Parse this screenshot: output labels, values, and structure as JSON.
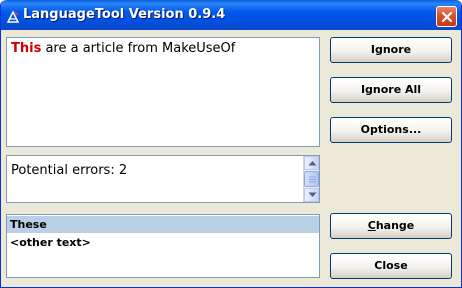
{
  "window": {
    "title": "LanguageTool Version 0.9.4",
    "accent": "#0054E3",
    "close_color": "#D9522C"
  },
  "editor": {
    "error_word": "This",
    "rest_text": " are a article from MakeUseOf",
    "error_color": "#CC0000"
  },
  "messages": {
    "text": "Potential errors: 2"
  },
  "suggestions": {
    "items": [
      {
        "label": "These",
        "selected": true
      },
      {
        "label": "<other text>",
        "selected": false
      }
    ],
    "selected_color": "#B8CFE5"
  },
  "buttons": {
    "ignore": "Ignore",
    "ignore_all": "Ignore All",
    "options": "Options...",
    "change_first": "C",
    "change_rest": "hange",
    "close": "Close"
  },
  "icons": {
    "app": "languagetool-app-icon",
    "close": "close-icon",
    "scroll_up": "arrow-up-icon",
    "scroll_down": "arrow-down-icon"
  }
}
